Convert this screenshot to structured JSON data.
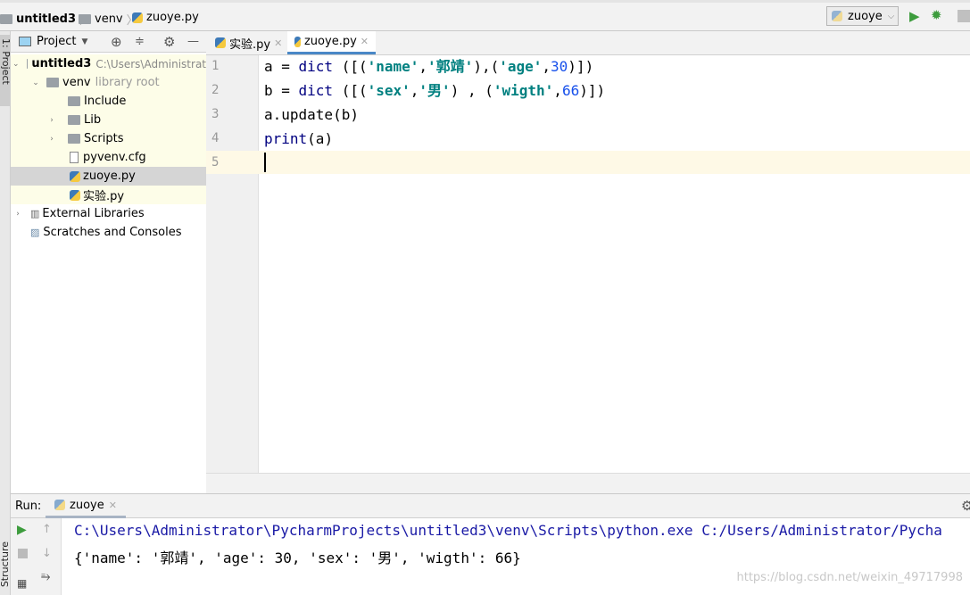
{
  "breadcrumb": [
    "untitled3",
    "venv",
    "zuoye.py"
  ],
  "run_config": {
    "label": "zuoye"
  },
  "left_strip": {
    "project_label": "1: Project",
    "structure_label": "Structure"
  },
  "project_panel": {
    "title": "Project"
  },
  "tree": [
    {
      "label": "untitled3",
      "hint": "C:\\Users\\Administrat",
      "icon": "folder-icon",
      "expanded": true
    },
    {
      "label": "venv",
      "hint": "library root",
      "icon": "folder-icon",
      "expanded": true
    },
    {
      "label": "Include",
      "icon": "folder-icon"
    },
    {
      "label": "Lib",
      "icon": "folder-icon",
      "expanded": false
    },
    {
      "label": "Scripts",
      "icon": "folder-icon",
      "expanded": false
    },
    {
      "label": "pyvenv.cfg",
      "icon": "file-icon"
    },
    {
      "label": "zuoye.py",
      "icon": "python-file-icon",
      "selected": true
    },
    {
      "label": "实验.py",
      "icon": "python-file-icon"
    },
    {
      "label": "External Libraries",
      "icon": "library-icon",
      "expanded": false
    },
    {
      "label": "Scratches and Consoles",
      "icon": "scratch-icon"
    }
  ],
  "tabs": [
    {
      "label": "实验.py"
    },
    {
      "label": "zuoye.py",
      "active": true
    }
  ],
  "editor": {
    "line_numbers": [
      "1",
      "2",
      "3",
      "4",
      "5"
    ],
    "lines": [
      [
        [
          "a = ",
          "p"
        ],
        [
          "dict",
          "k"
        ],
        [
          " ([(",
          "p"
        ],
        [
          "'name'",
          "s"
        ],
        [
          ",",
          "p"
        ],
        [
          "'郭靖'",
          "s"
        ],
        [
          "),(",
          "p"
        ],
        [
          "'age'",
          "s"
        ],
        [
          ",",
          "p"
        ],
        [
          "30",
          "n"
        ],
        [
          ")])",
          "p"
        ]
      ],
      [
        [
          "b = ",
          "p"
        ],
        [
          "dict",
          "k"
        ],
        [
          " ([(",
          "p"
        ],
        [
          "'sex'",
          "s"
        ],
        [
          ",",
          "p"
        ],
        [
          "'男'",
          "s"
        ],
        [
          ") , (",
          "p"
        ],
        [
          "'wigth'",
          "s"
        ],
        [
          ",",
          "p"
        ],
        [
          "66",
          "n"
        ],
        [
          ")])",
          "p"
        ]
      ],
      [
        [
          "a.update(b)",
          "p"
        ]
      ],
      [
        [
          "print",
          "k"
        ],
        [
          "(a)",
          "p"
        ]
      ],
      []
    ]
  },
  "run": {
    "label": "Run:",
    "tab": "zuoye",
    "output": [
      "C:\\Users\\Administrator\\PycharmProjects\\untitled3\\venv\\Scripts\\python.exe C:/Users/Administrator/Pycha",
      "{'name': '郭靖', 'age': 30, 'sex': '男', 'wigth': 66}"
    ]
  },
  "watermark": "https://blog.csdn.net/weixin_49717998"
}
